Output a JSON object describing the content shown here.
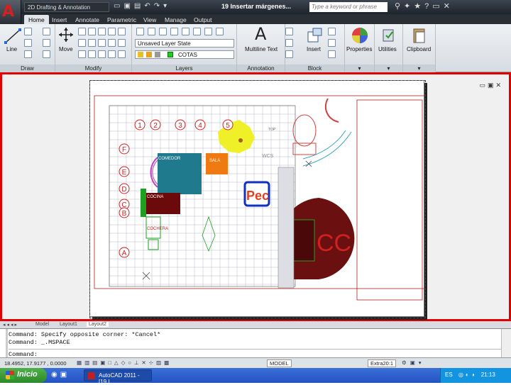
{
  "window": {
    "app_letter": "A",
    "workspace": "2D Drafting & Annotation",
    "document_title": "19 Insertar márgenes...",
    "search_placeholder": "Type a keyword or phrase"
  },
  "tabs": [
    {
      "label": "Home",
      "active": true
    },
    {
      "label": "Insert",
      "active": false
    },
    {
      "label": "Annotate",
      "active": false
    },
    {
      "label": "Parametric",
      "active": false
    },
    {
      "label": "View",
      "active": false
    },
    {
      "label": "Manage",
      "active": false
    },
    {
      "label": "Output",
      "active": false
    }
  ],
  "ribbon": {
    "draw": {
      "label": "Draw",
      "line": "Line"
    },
    "modify": {
      "label": "Modify",
      "move": "Move"
    },
    "layers": {
      "label": "Layers",
      "layer_state": "Unsaved Layer State",
      "current_layer": "COTAS"
    },
    "annotation": {
      "label": "Annotation",
      "multiline_text": "Multiline Text",
      "big_letter": "A"
    },
    "block": {
      "label": "Block",
      "insert": "Insert"
    },
    "properties": "Properties",
    "utilities": "Utilities",
    "clipboard": "Clipboard"
  },
  "drawing": {
    "room_labels": {
      "comedor": "COMEDOR",
      "sala": "SALA",
      "cocina": "COCINA",
      "cochera": "COCHERA"
    },
    "axis_numbers": [
      "1",
      "2",
      "3",
      "4",
      "5"
    ],
    "axis_letters": [
      "F",
      "E",
      "D",
      "C",
      "B",
      "A"
    ],
    "wcs_label": "WCS",
    "top_label": "TOP",
    "big_text": "CC",
    "logo_text": "Pec"
  },
  "layout_tabs": [
    "Model",
    "Layout1",
    "Layout2"
  ],
  "command": {
    "line1": "Command: Specify opposite corner: *Cancel*",
    "line2": "Command: _.MSPACE",
    "prompt": "Command:"
  },
  "status": {
    "coords": "18.4952, 17.9177 , 0.0000",
    "model": "MODEL",
    "scale": "Extra20:1"
  },
  "taskbar": {
    "start": "Inicio",
    "app": "AutoCAD 2011 - [19 I...",
    "lang": "ES",
    "time": "21:13"
  },
  "colors": {
    "frame_red": "#e00000",
    "room_teal": "#1e7a8c",
    "room_orange": "#f07a12",
    "dark_red": "#6a0a0a",
    "yellow": "#f0f028",
    "grid": "#b8b8c8",
    "logo_blue": "#1030c0"
  }
}
